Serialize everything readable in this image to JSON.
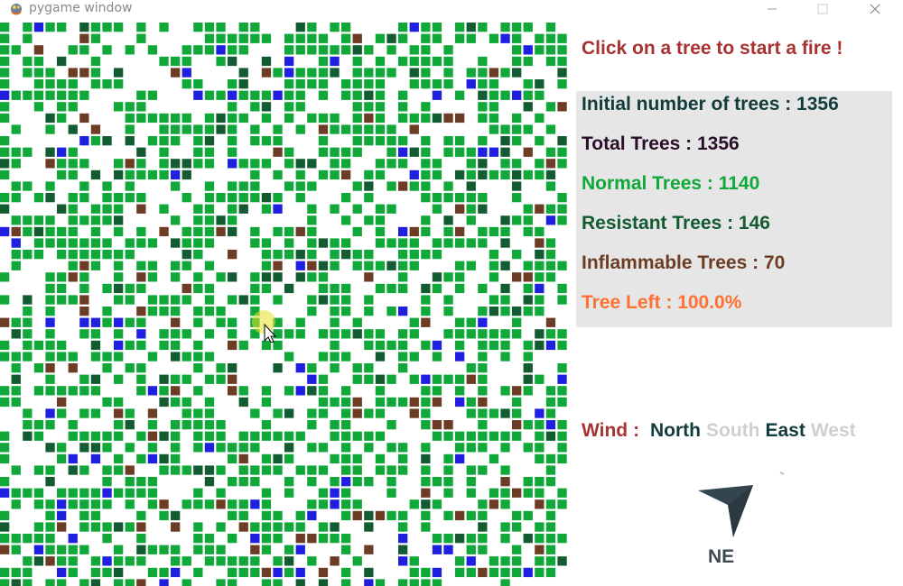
{
  "window": {
    "title": "pygame window",
    "icon": "pygame-snake-icon",
    "controls": [
      "minimize-icon",
      "maximize-icon",
      "close-icon"
    ]
  },
  "grid": {
    "colors": {
      "normal": "#11a83a",
      "resistant": "#135c32",
      "inflammable": "#6d3c24",
      "water": "#1f1fe0",
      "empty": "#ffffff"
    }
  },
  "panel": {
    "hint": "Click on a tree to start a fire !",
    "stats": [
      {
        "text": "Initial number of trees : 1356",
        "color": "#123c3c"
      },
      {
        "text": "Total Trees : 1356",
        "color": "#2a0f2a"
      },
      {
        "text": "Normal Trees : 1140",
        "color": "#11a83a"
      },
      {
        "text": "Resistant Trees : 146",
        "color": "#135c32"
      },
      {
        "text": "Inflammable Trees : 70",
        "color": "#6d3c24"
      },
      {
        "text": "Tree Left : 100.0%",
        "color": "#ff7133"
      }
    ],
    "background": "#e6e6e6"
  },
  "wind": {
    "label": "Wind",
    "separator": ":",
    "directions": [
      {
        "text": "North",
        "active": true
      },
      {
        "text": "South",
        "active": false
      },
      {
        "text": "East",
        "active": true
      },
      {
        "text": "West",
        "active": false
      }
    ],
    "compass_label": "NE",
    "compass_icon": "navigation-arrow-icon",
    "label_color": "#a83232",
    "active_color": "#123c3c",
    "inactive_color": "#cfcfcf"
  }
}
